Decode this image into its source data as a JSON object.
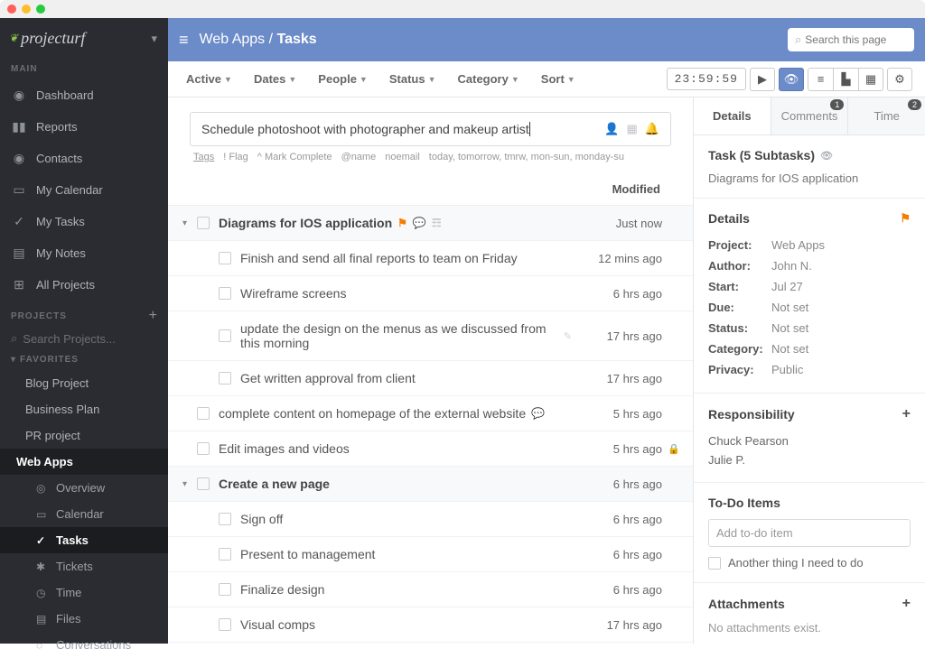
{
  "brand": "projecturf",
  "sidebar": {
    "sections": {
      "main": "MAIN",
      "projects": "PROJECTS",
      "favorites": "FAVORITES"
    },
    "main_items": [
      {
        "icon": "◉",
        "label": "Dashboard"
      },
      {
        "icon": "▮▮",
        "label": "Reports"
      },
      {
        "icon": "◉",
        "label": "Contacts"
      },
      {
        "icon": "▭",
        "label": "My Calendar"
      },
      {
        "icon": "✓",
        "label": "My Tasks"
      },
      {
        "icon": "▤",
        "label": "My Notes"
      },
      {
        "icon": "⊞",
        "label": "All Projects"
      }
    ],
    "search_placeholder": "Search Projects...",
    "projects": [
      {
        "label": "Blog Project"
      },
      {
        "label": "Business Plan"
      },
      {
        "label": "PR project"
      },
      {
        "label": "Web Apps",
        "active": true
      }
    ],
    "sub_items": [
      {
        "icon": "◎",
        "label": "Overview"
      },
      {
        "icon": "▭",
        "label": "Calendar"
      },
      {
        "icon": "✓",
        "label": "Tasks",
        "active": true
      },
      {
        "icon": "✱",
        "label": "Tickets"
      },
      {
        "icon": "◷",
        "label": "Time"
      },
      {
        "icon": "▤",
        "label": "Files"
      },
      {
        "icon": "◌",
        "label": "Conversations"
      }
    ]
  },
  "header": {
    "breadcrumb_a": "Web Apps",
    "breadcrumb_b": "Tasks",
    "search_placeholder": "Search this page"
  },
  "toolbar": {
    "filters": [
      "Active",
      "Dates",
      "People",
      "Status",
      "Category",
      "Sort"
    ],
    "timer": "23:59:59"
  },
  "new_task": {
    "value": "Schedule photoshoot with photographer and makeup artist",
    "hints": [
      "Tags",
      "! Flag",
      "^ Mark Complete",
      "@name",
      "noemail",
      "today, tomorrow, tmrw, mon-sun, monday-su"
    ]
  },
  "columns": {
    "modified": "Modified"
  },
  "tasks": [
    {
      "group": true,
      "title": "Diagrams for IOS application",
      "mod": "Just now",
      "flag": true,
      "comment": true,
      "list": true
    },
    {
      "indent": true,
      "title": "Finish and send all final reports to team on Friday",
      "mod": "12 mins ago"
    },
    {
      "indent": true,
      "title": "Wireframe screens",
      "mod": "6 hrs ago"
    },
    {
      "indent": true,
      "title": "update the design on the menus as we discussed from this morning",
      "mod": "17 hrs ago",
      "pencil": true
    },
    {
      "indent": true,
      "title": "Get written approval from client",
      "mod": "17 hrs ago"
    },
    {
      "title": "complete content on homepage of the external website",
      "mod": "5 hrs ago",
      "comment": true
    },
    {
      "title": "Edit images and videos",
      "mod": "5 hrs ago",
      "lock": true
    },
    {
      "group": true,
      "title": "Create a new page",
      "mod": "6 hrs ago"
    },
    {
      "indent": true,
      "title": "Sign off",
      "mod": "6 hrs ago"
    },
    {
      "indent": true,
      "title": "Present to management",
      "mod": "6 hrs ago"
    },
    {
      "indent": true,
      "title": "Finalize design",
      "mod": "6 hrs ago"
    },
    {
      "indent": true,
      "title": "Visual comps",
      "mod": "17 hrs ago"
    }
  ],
  "detail": {
    "tabs": [
      {
        "label": "Details",
        "active": true
      },
      {
        "label": "Comments",
        "badge": "1"
      },
      {
        "label": "Time",
        "badge": "2"
      }
    ],
    "heading": "Task (5 Subtasks)",
    "subheading": "Diagrams for IOS application",
    "details_title": "Details",
    "fields": [
      {
        "k": "Project:",
        "v": "Web Apps"
      },
      {
        "k": "Author:",
        "v": "John N."
      },
      {
        "k": "Start:",
        "v": "Jul 27"
      },
      {
        "k": "Due:",
        "v": "Not set"
      },
      {
        "k": "Status:",
        "v": "Not set"
      },
      {
        "k": "Category:",
        "v": "Not set"
      },
      {
        "k": "Privacy:",
        "v": "Public"
      }
    ],
    "responsibility_title": "Responsibility",
    "responsible": [
      "Chuck Pearson",
      "Julie P."
    ],
    "todo_title": "To-Do Items",
    "todo_placeholder": "Add to-do item",
    "todo_items": [
      "Another thing I need to do"
    ],
    "attachments_title": "Attachments",
    "no_attachments": "No attachments exist."
  }
}
